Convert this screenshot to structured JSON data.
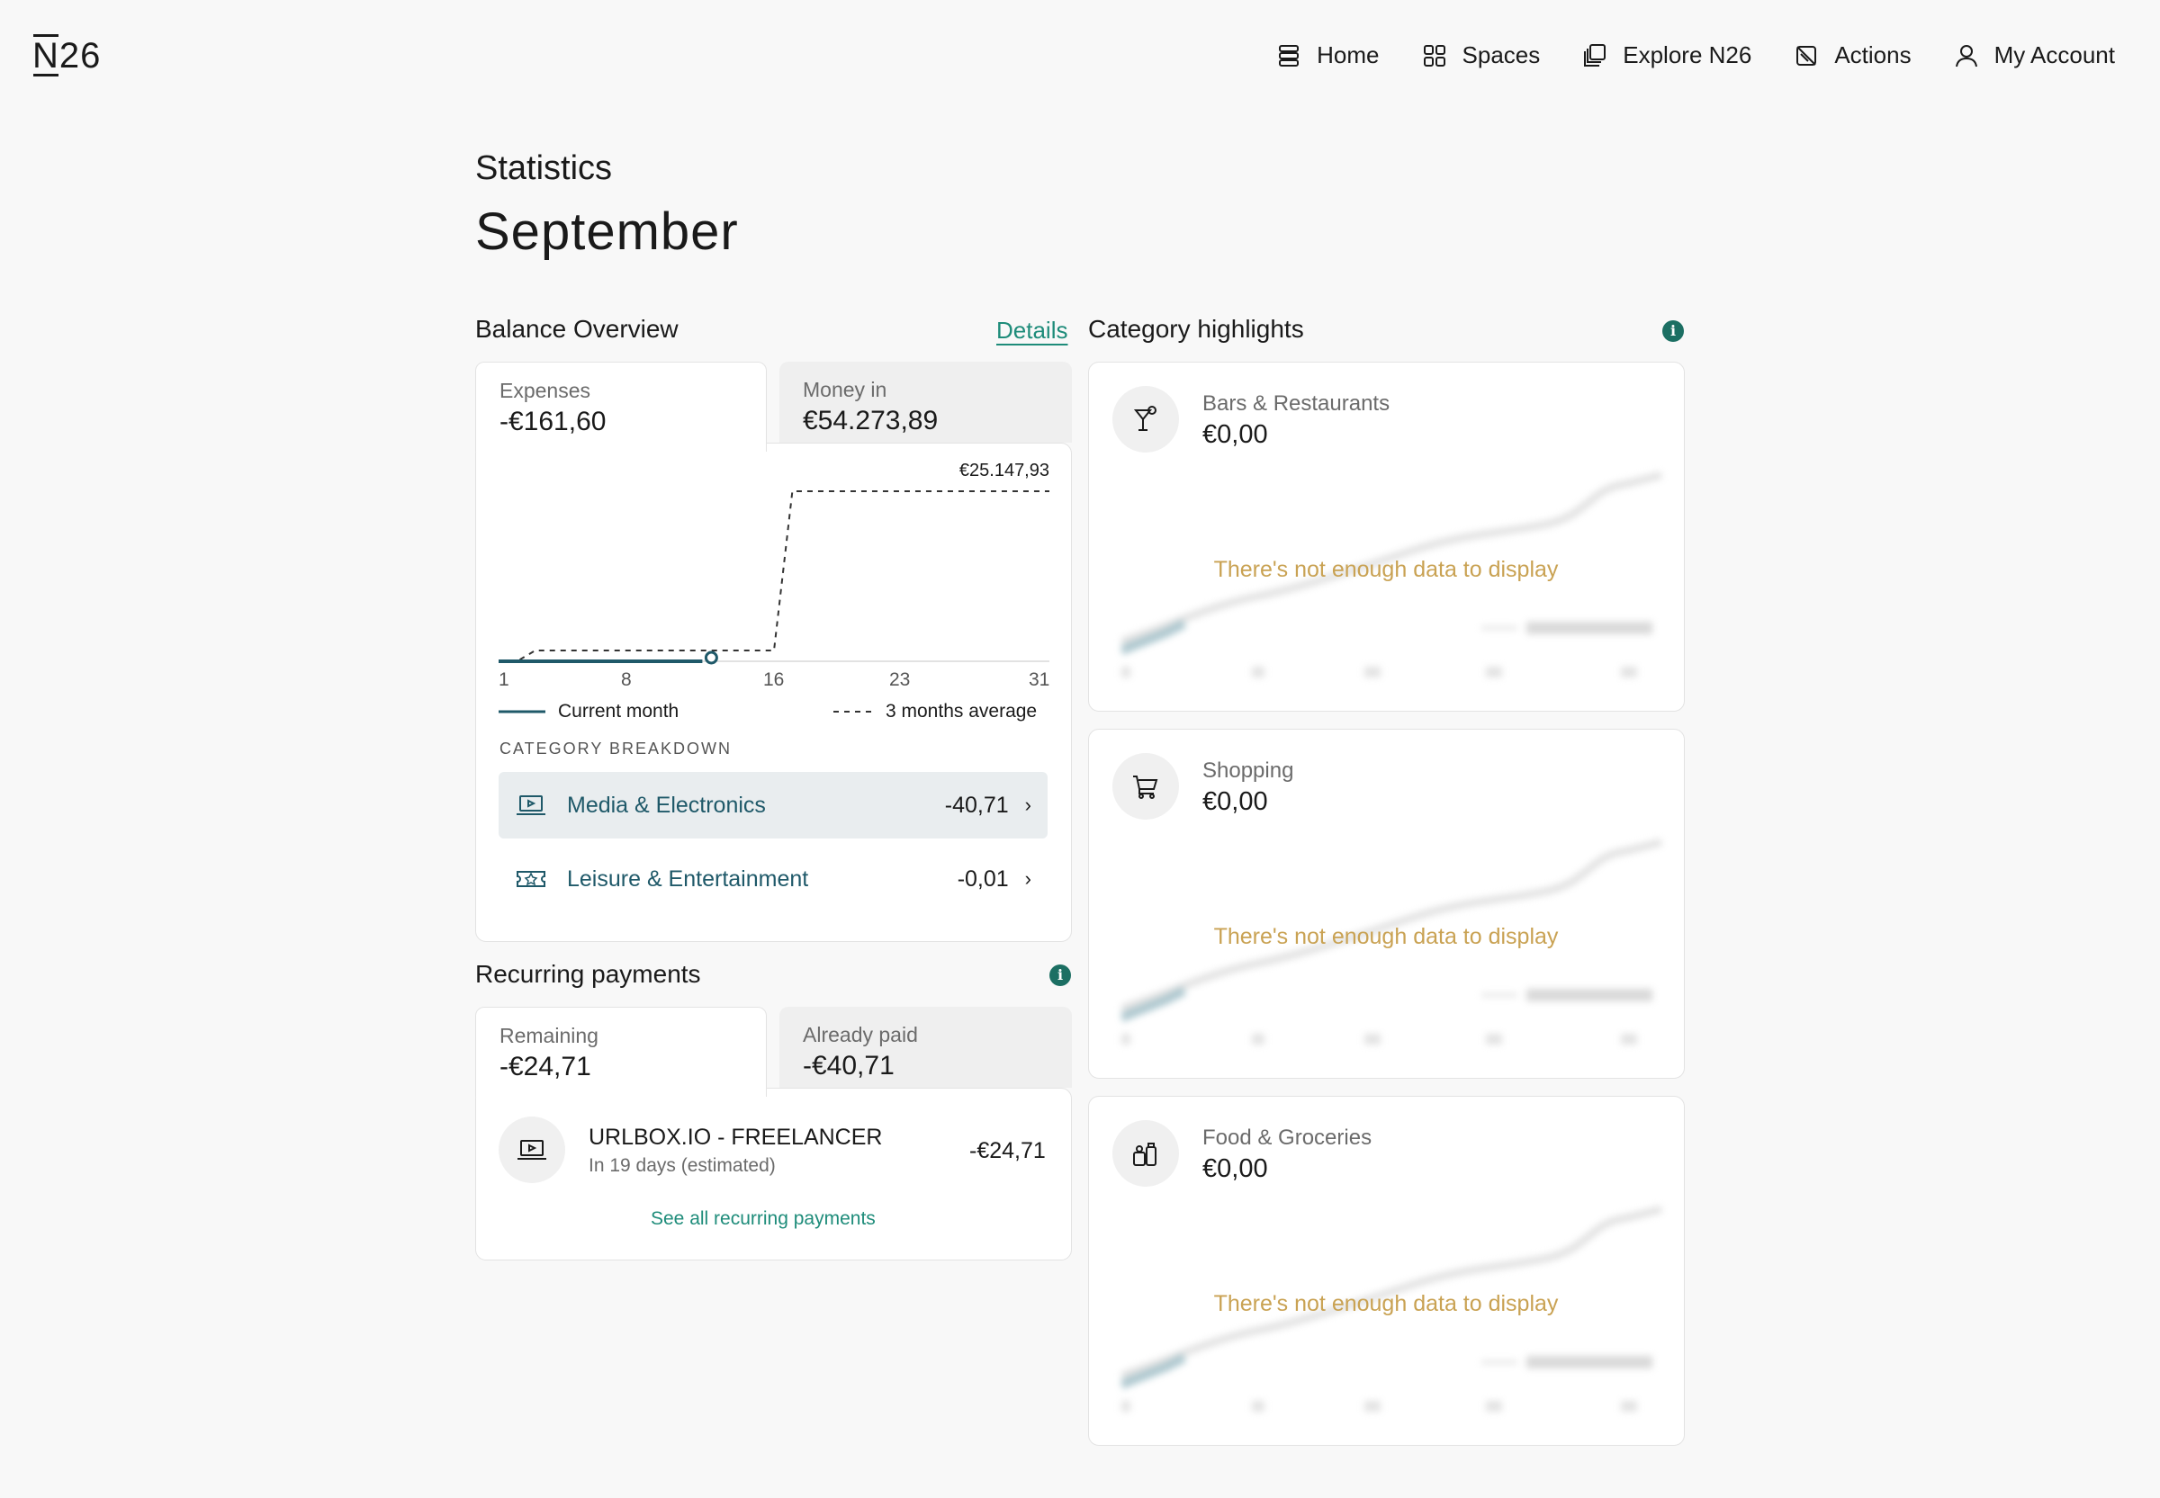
{
  "brand": {
    "logo_n": "N",
    "logo_rest": "26"
  },
  "nav": {
    "home": "Home",
    "spaces": "Spaces",
    "explore": "Explore N26",
    "actions": "Actions",
    "account": "My Account"
  },
  "page": {
    "title": "Statistics",
    "month": "September"
  },
  "balance": {
    "title": "Balance Overview",
    "details_link": "Details",
    "tabs": [
      {
        "label": "Expenses",
        "value": "-€161,60",
        "active": true
      },
      {
        "label": "Money in",
        "value": "€54.273,89",
        "active": false
      }
    ],
    "chart_data": {
      "type": "line",
      "x_ticks": [
        "1",
        "8",
        "16",
        "23",
        "31"
      ],
      "peak_label": "€25.147,93",
      "series": [
        {
          "name": "Current month",
          "x": [
            1,
            4,
            8,
            12,
            12
          ],
          "y": [
            0,
            0,
            0,
            0,
            0.5
          ]
        },
        {
          "name": "3 months average",
          "x": [
            1,
            2,
            3,
            16,
            17,
            31
          ],
          "y": [
            0,
            0,
            1,
            1,
            25147.93,
            25147.93
          ]
        }
      ],
      "ylim": [
        0,
        25147.93
      ]
    },
    "legend": {
      "current": "Current month",
      "average": "3 months average"
    },
    "category_breakdown": {
      "title": "CATEGORY BREAKDOWN",
      "items": [
        {
          "name": "Media & Electronics",
          "amount": "-40,71",
          "icon": "laptop-icon",
          "selected": true
        },
        {
          "name": "Leisure & Entertainment",
          "amount": "-0,01",
          "icon": "ticket-icon",
          "selected": false
        }
      ]
    }
  },
  "recurring": {
    "title": "Recurring payments",
    "tabs": [
      {
        "label": "Remaining",
        "value": "-€24,71",
        "active": true
      },
      {
        "label": "Already paid",
        "value": "-€40,71",
        "active": false
      }
    ],
    "items": [
      {
        "name": "URLBOX.IO - FREELANCER",
        "sub": "In 19 days (estimated)",
        "amount": "-€24,71",
        "icon": "laptop-icon"
      }
    ],
    "see_all": "See all recurring payments"
  },
  "highlights": {
    "title": "Category highlights",
    "empty_message": "There's not enough data to display",
    "items": [
      {
        "name": "Bars & Restaurants",
        "value": "€0,00",
        "icon": "cocktail-icon"
      },
      {
        "name": "Shopping",
        "value": "€0,00",
        "icon": "cart-icon"
      },
      {
        "name": "Food & Groceries",
        "value": "€0,00",
        "icon": "groceries-icon"
      }
    ]
  },
  "colors": {
    "accent": "#1e8c7a",
    "teal_dark": "#1f5969",
    "warning_text": "#c9a253"
  }
}
